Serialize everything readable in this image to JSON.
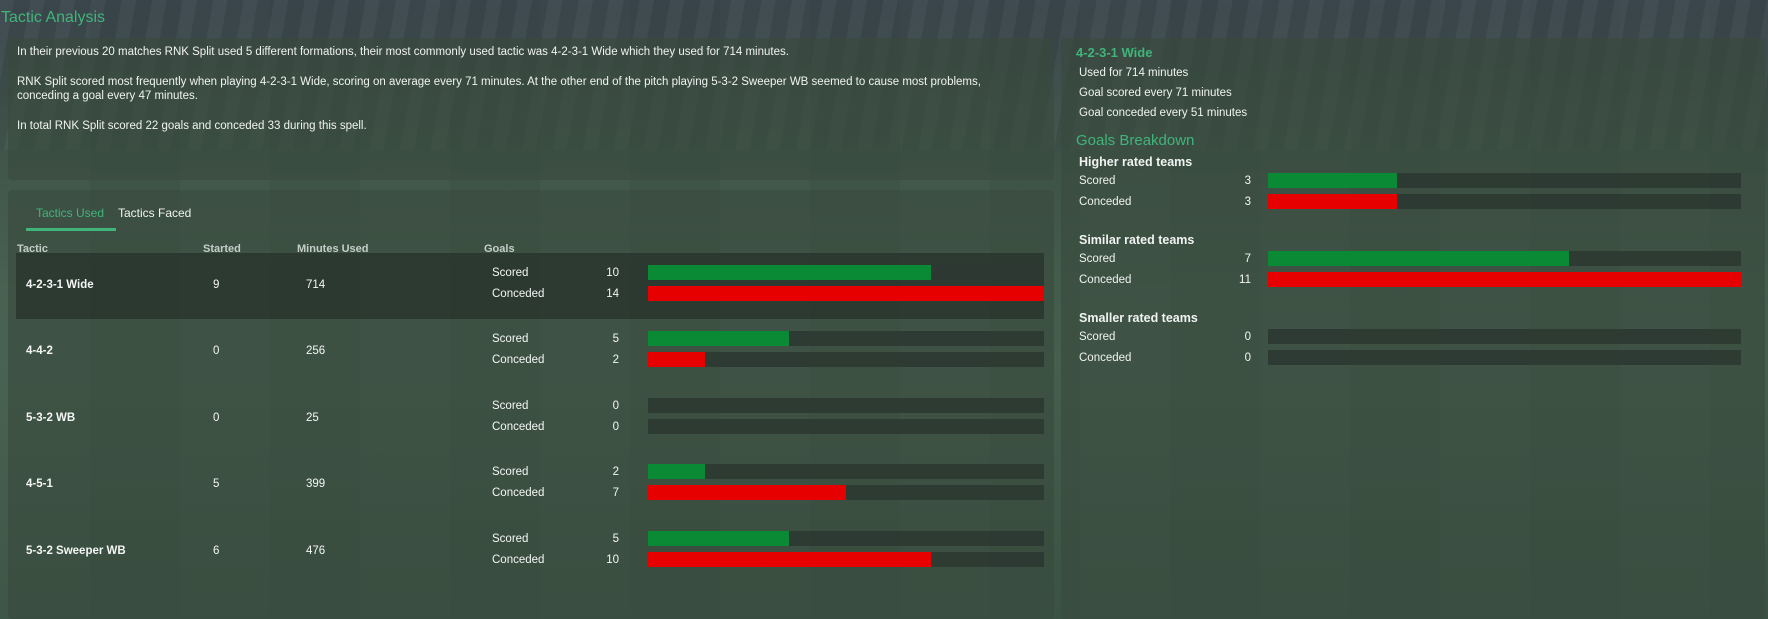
{
  "page": {
    "title": "Tactic Analysis"
  },
  "summary": {
    "line1": "In their previous 20 matches RNK Split used 5 different formations, their most commonly used tactic was 4-2-3-1 Wide which they used for 714 minutes.",
    "line2a": "RNK Split scored most frequently when playing 4-2-3-1 Wide, scoring on average every 71 minutes. At the other end of the pitch playing 5-3-2 Sweeper WB seemed to cause most problems,",
    "line2b": "conceding a goal every 47 minutes.",
    "line3": "In total RNK Split scored 22 goals and conceded 33 during this spell."
  },
  "tabs": {
    "used": "Tactics Used",
    "faced": "Tactics Faced"
  },
  "table": {
    "headers": {
      "tactic": "Tactic",
      "started": "Started",
      "minutes": "Minutes Used",
      "goals": "Goals"
    },
    "scored_label": "Scored",
    "conceded_label": "Conceded",
    "max_goals": 14,
    "rows": [
      {
        "tactic": "4-2-3-1 Wide",
        "started": "9",
        "minutes": "714",
        "scored": 10,
        "conceded": 14
      },
      {
        "tactic": "4-4-2",
        "started": "0",
        "minutes": "256",
        "scored": 5,
        "conceded": 2
      },
      {
        "tactic": "5-3-2 WB",
        "started": "0",
        "minutes": "25",
        "scored": 0,
        "conceded": 0
      },
      {
        "tactic": "4-5-1",
        "started": "5",
        "minutes": "399",
        "scored": 2,
        "conceded": 7
      },
      {
        "tactic": "5-3-2 Sweeper WB",
        "started": "6",
        "minutes": "476",
        "scored": 5,
        "conceded": 10
      }
    ]
  },
  "side": {
    "tactic_title": "4-2-3-1 Wide",
    "used_for": "Used for 714 minutes",
    "goal_scored": "Goal scored every 71 minutes",
    "goal_conceded": "Goal conceded every 51 minutes",
    "breakdown_title": "Goals Breakdown",
    "max_goals": 11,
    "groups": [
      {
        "name": "Higher rated teams",
        "scored": 3,
        "conceded": 3
      },
      {
        "name": "Similar rated teams",
        "scored": 7,
        "conceded": 11
      },
      {
        "name": "Smaller rated teams",
        "scored": 0,
        "conceded": 0
      }
    ]
  },
  "colors": {
    "accent": "#3fb57a",
    "scored": "#0b8a35",
    "conceded": "#e60000"
  }
}
